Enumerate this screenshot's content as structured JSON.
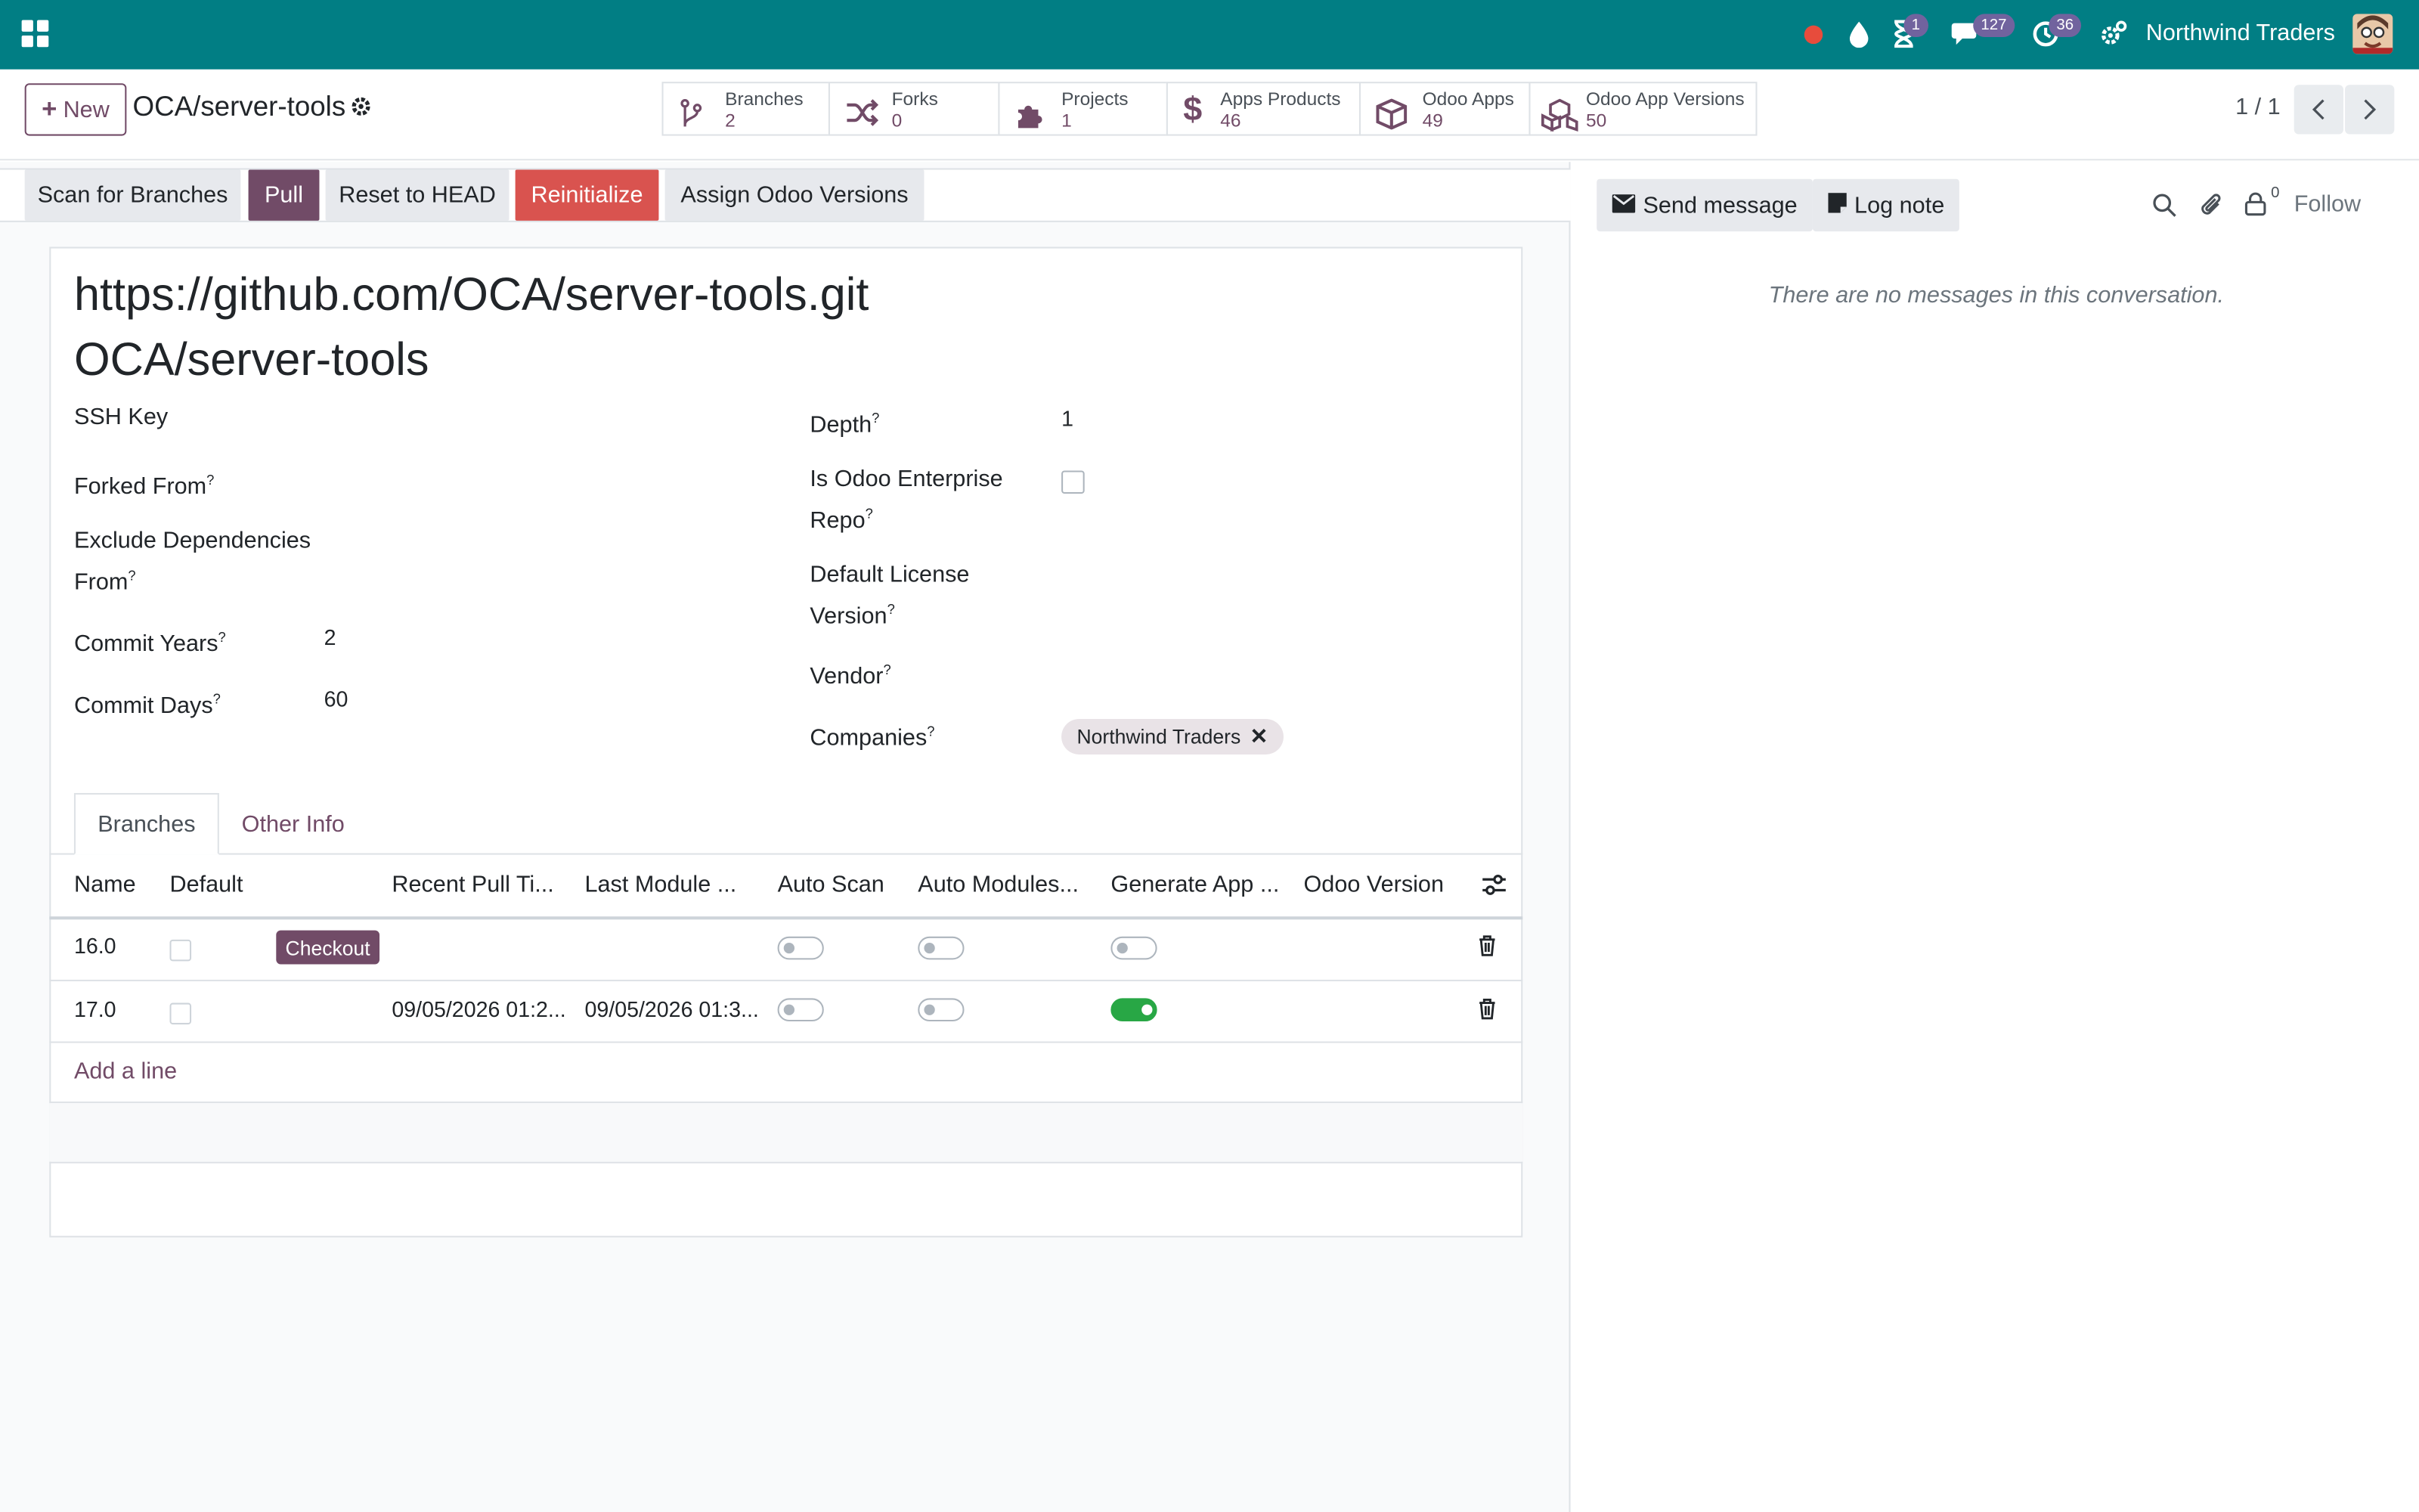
{
  "topbar": {
    "company": "Northwind Traders",
    "badge_activity": "1",
    "badge_messages": "127",
    "badge_timer": "36",
    "accent": "#017e84"
  },
  "control": {
    "new_label": "New",
    "breadcrumb": "OCA/server-tools",
    "pager": "1 / 1",
    "smart_buttons": [
      {
        "label": "Branches",
        "value": "2",
        "icon": "branch-icon"
      },
      {
        "label": "Forks",
        "value": "0",
        "icon": "fork-icon"
      },
      {
        "label": "Projects",
        "value": "1",
        "icon": "puzzle-icon"
      },
      {
        "label": "Apps Products",
        "value": "46",
        "icon": "dollar-icon"
      },
      {
        "label": "Odoo Apps",
        "value": "49",
        "icon": "cube-icon"
      },
      {
        "label": "Odoo App Versions",
        "value": "50",
        "icon": "cubes-icon"
      }
    ]
  },
  "header_buttons": {
    "scan": "Scan for Branches",
    "pull": "Pull",
    "reset": "Reset to HEAD",
    "reinit": "Reinitialize",
    "assign": "Assign Odoo Versions"
  },
  "form": {
    "url": "https://github.com/OCA/server-tools.git",
    "name": "OCA/server-tools",
    "ssh_key_label": "SSH Key",
    "forked_from_label": "Forked From",
    "exclude_label_1": "Exclude Dependencies",
    "exclude_label_2": "From",
    "commit_years_label": "Commit Years",
    "commit_years": "2",
    "commit_days_label": "Commit Days",
    "commit_days": "60",
    "depth_label": "Depth",
    "depth": "1",
    "enterprise_label_1": "Is Odoo Enterprise",
    "enterprise_label_2": "Repo",
    "license_label_1": "Default License",
    "license_label_2": "Version",
    "vendor_label": "Vendor",
    "companies_label": "Companies",
    "company_tag": "Northwind Traders",
    "help": "?"
  },
  "tabs": {
    "branches": "Branches",
    "other": "Other Info"
  },
  "table": {
    "headers": [
      "Name",
      "Default",
      "Recent Pull Ti...",
      "Last Module ...",
      "Auto Scan",
      "Auto Modules...",
      "Generate App ...",
      "Odoo Version"
    ],
    "rows": [
      {
        "name": "16.0",
        "default": false,
        "checkout": "Checkout",
        "recent_pull": "",
        "last_module": "",
        "auto_scan": false,
        "auto_modules": false,
        "generate_app": false
      },
      {
        "name": "17.0",
        "default": false,
        "checkout": "",
        "recent_pull": "09/05/2026 01:2...",
        "last_module": "09/05/2026 01:3...",
        "auto_scan": false,
        "auto_modules": false,
        "generate_app": true
      }
    ],
    "add_line": "Add a line"
  },
  "chatter": {
    "send": "Send message",
    "log": "Log note",
    "followers": "0",
    "follow": "Follow",
    "empty": "There are no messages in this conversation."
  }
}
